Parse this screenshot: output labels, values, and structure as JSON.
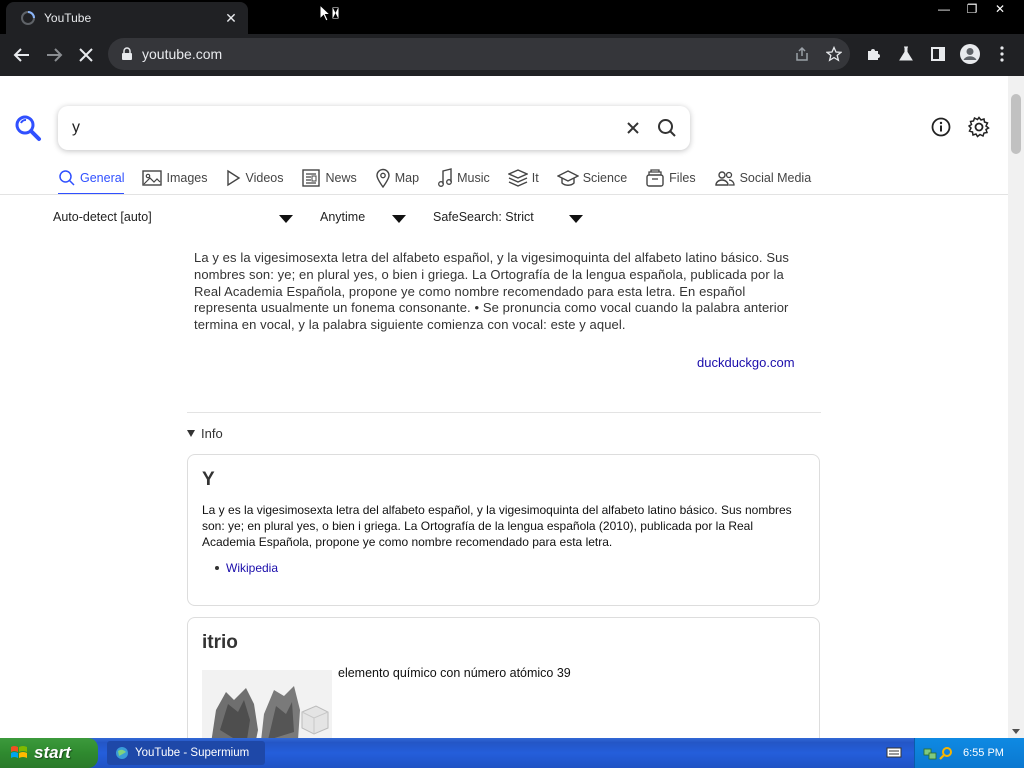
{
  "browser": {
    "tab_title": "YouTube",
    "url": "youtube.com",
    "tab_close_glyph": "✕",
    "window_controls": [
      "—",
      "❐",
      "✕"
    ]
  },
  "search": {
    "query": "y",
    "icons": [
      "clear-icon",
      "search-icon",
      "info-icon",
      "gear-icon"
    ]
  },
  "categories": [
    {
      "label": "General",
      "icon": "search-icon",
      "active": true
    },
    {
      "label": "Images",
      "icon": "image-icon"
    },
    {
      "label": "Videos",
      "icon": "play-icon"
    },
    {
      "label": "News",
      "icon": "newspaper-icon"
    },
    {
      "label": "Map",
      "icon": "map-pin-icon"
    },
    {
      "label": "Music",
      "icon": "music-icon"
    },
    {
      "label": "It",
      "icon": "layers-icon"
    },
    {
      "label": "Science",
      "icon": "graduation-cap-icon"
    },
    {
      "label": "Files",
      "icon": "files-icon"
    },
    {
      "label": "Social Media",
      "icon": "people-icon"
    }
  ],
  "filters": {
    "language": "Auto-detect [auto]",
    "time": "Anytime",
    "safesearch": "SafeSearch: Strict"
  },
  "answer": {
    "text": "La y es la vigesimosexta letra del alfabeto español, y la vigesimoquinta del alfabeto latino básico. Sus nombres son: ye; en plural yes, o bien i griega. La Ortografía de la lengua española, publicada por la Real Academia Española, propone ye como nombre recomendado para esta letra. En español representa usualmente un fonema consonante. • Se pronuncia como vocal cuando la palabra anterior termina en vocal, y la palabra siguiente comienza con vocal: este y aquel.",
    "source": "duckduckgo.com"
  },
  "info": {
    "toggle_label": "Info",
    "cards": [
      {
        "title": "Y",
        "body": "La y es la vigesimosexta letra del alfabeto español, y la vigesimoquinta del alfabeto latino básico. Sus nombres son: ye; en plural yes, o bien i griega. La Ortografía de la lengua española (2010), publicada por la Real Academia Española, propone ye como nombre recomendado para esta letra.",
        "link": "Wikipedia"
      },
      {
        "title": "itrio",
        "body": "elemento químico con número atómico 39"
      }
    ]
  },
  "taskbar": {
    "start_label": "start",
    "task_item": "YouTube - Supermium",
    "clock": "6:55 PM"
  },
  "colors": {
    "accent": "#3050ff",
    "link": "#1a0dab",
    "browser_dark": "#202124"
  }
}
